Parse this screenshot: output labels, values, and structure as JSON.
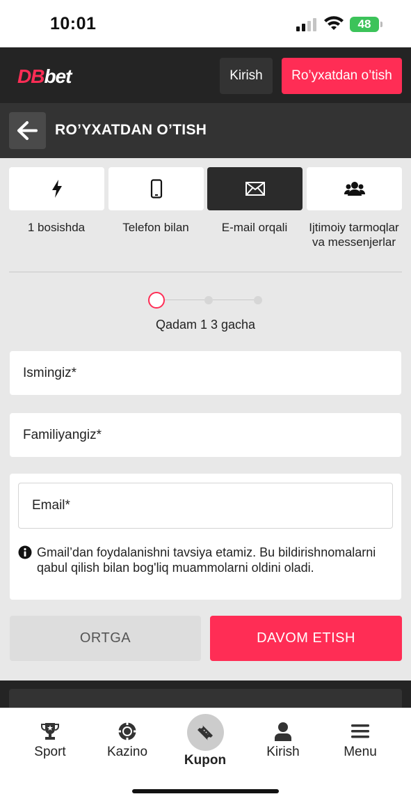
{
  "status_bar": {
    "time": "10:01",
    "battery": "48"
  },
  "header": {
    "logo_db": "DB",
    "logo_bet": "bet",
    "login_label": "Kirish",
    "register_label": "Ro’yxatdan o’tish"
  },
  "title_bar": {
    "title": "RO’YXATDAN O’TISH"
  },
  "tabs": [
    {
      "label": "1 bosishda",
      "icon": "lightning-icon",
      "active": false
    },
    {
      "label": "Telefon bilan",
      "icon": "phone-icon",
      "active": false
    },
    {
      "label": "E-mail orqali",
      "icon": "envelope-icon",
      "active": true
    },
    {
      "label": "Ijtimoiy tarmoqlar va messenjerlar",
      "icon": "users-icon",
      "active": false
    }
  ],
  "stepper": {
    "current": 1,
    "total": 3,
    "text": "Qadam 1 3 gacha"
  },
  "form": {
    "first_name_placeholder": "Ismingiz*",
    "last_name_placeholder": "Familiyangiz*",
    "email_placeholder": "Email*",
    "info_text": "Gmail’dan foydalanishni tavsiya etamiz. Bu bildirishnomalarni qabul qilish bilan bog'liq muammolarni oldini oladi."
  },
  "buttons": {
    "back_label": "ORTGA",
    "continue_label": "DAVOM ETISH"
  },
  "bottom_nav": {
    "sport": "Sport",
    "casino": "Kazino",
    "coupon": "Kupon",
    "login": "Kirish",
    "menu": "Menu"
  },
  "colors": {
    "accent": "#ff2d55",
    "header_bg": "#242424",
    "title_bg": "#333333",
    "content_bg": "#e8e8e8"
  }
}
